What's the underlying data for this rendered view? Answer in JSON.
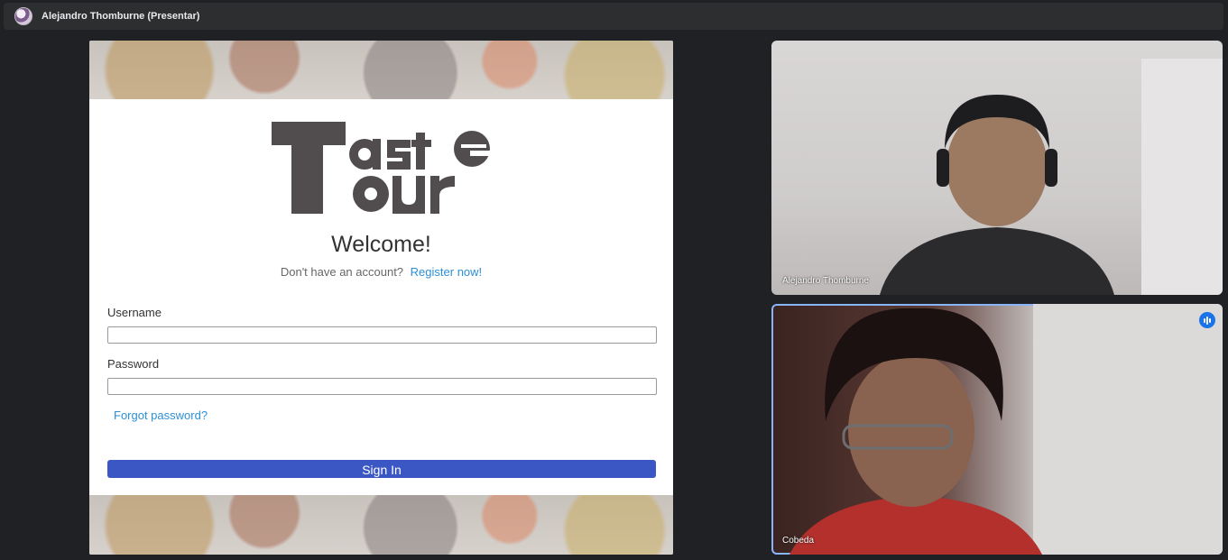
{
  "presenter_bar": {
    "title": "Alejandro Thomburne (Presentar)"
  },
  "shared_screen": {
    "logo_text": "Taste Tour",
    "welcome": "Welcome!",
    "no_account_text": "Don't have an account?",
    "register_link": "Register now!",
    "username_label": "Username",
    "username_value": "",
    "password_label": "Password",
    "password_value": "",
    "forgot_link": "Forgot password?",
    "signin_label": "Sign In",
    "button_color": "#3b57c4",
    "link_color": "#2d8fd6"
  },
  "participants": [
    {
      "name": "Alejandro Thomburne",
      "speaking": false
    },
    {
      "name": "Cobeda",
      "speaking": true
    }
  ]
}
